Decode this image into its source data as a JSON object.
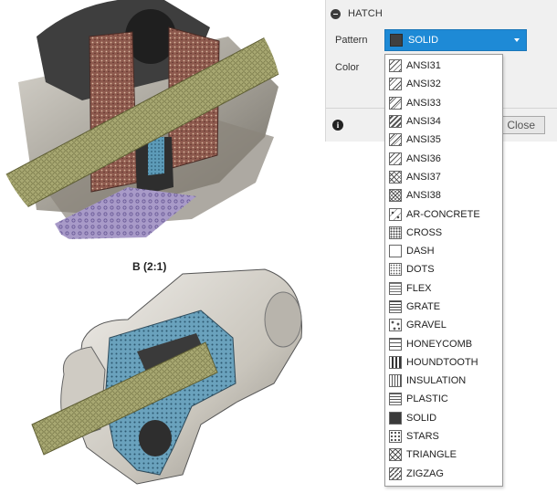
{
  "panel": {
    "title": "HATCH",
    "pattern_label": "Pattern",
    "color_label": "Color",
    "selected_pattern": "SOLID",
    "close_label": "Close",
    "accent": "#1e8ad6"
  },
  "figure": {
    "caption": "B (2:1)"
  },
  "patterns": [
    {
      "label": "ANSI31",
      "icon": "ansi31"
    },
    {
      "label": "ANSI32",
      "icon": "ansi32"
    },
    {
      "label": "ANSI33",
      "icon": "ansi33"
    },
    {
      "label": "ANSI34",
      "icon": "ansi34"
    },
    {
      "label": "ANSI35",
      "icon": "ansi35"
    },
    {
      "label": "ANSI36",
      "icon": "ansi36"
    },
    {
      "label": "ANSI37",
      "icon": "ansi37"
    },
    {
      "label": "ANSI38",
      "icon": "ansi38"
    },
    {
      "label": "AR-CONCRETE",
      "icon": "ar-concrete"
    },
    {
      "label": "CROSS",
      "icon": "cross"
    },
    {
      "label": "DASH",
      "icon": "dash"
    },
    {
      "label": "DOTS",
      "icon": "dots"
    },
    {
      "label": "FLEX",
      "icon": "flex"
    },
    {
      "label": "GRATE",
      "icon": "grate"
    },
    {
      "label": "GRAVEL",
      "icon": "gravel"
    },
    {
      "label": "HONEYCOMB",
      "icon": "honeycomb"
    },
    {
      "label": "HOUNDTOOTH",
      "icon": "houndtooth"
    },
    {
      "label": "INSULATION",
      "icon": "insulation"
    },
    {
      "label": "PLASTIC",
      "icon": "plastic"
    },
    {
      "label": "SOLID",
      "icon": "solid"
    },
    {
      "label": "STARS",
      "icon": "stars"
    },
    {
      "label": "TRIANGLE",
      "icon": "triangle"
    },
    {
      "label": "ZIGZAG",
      "icon": "zigzag"
    }
  ]
}
